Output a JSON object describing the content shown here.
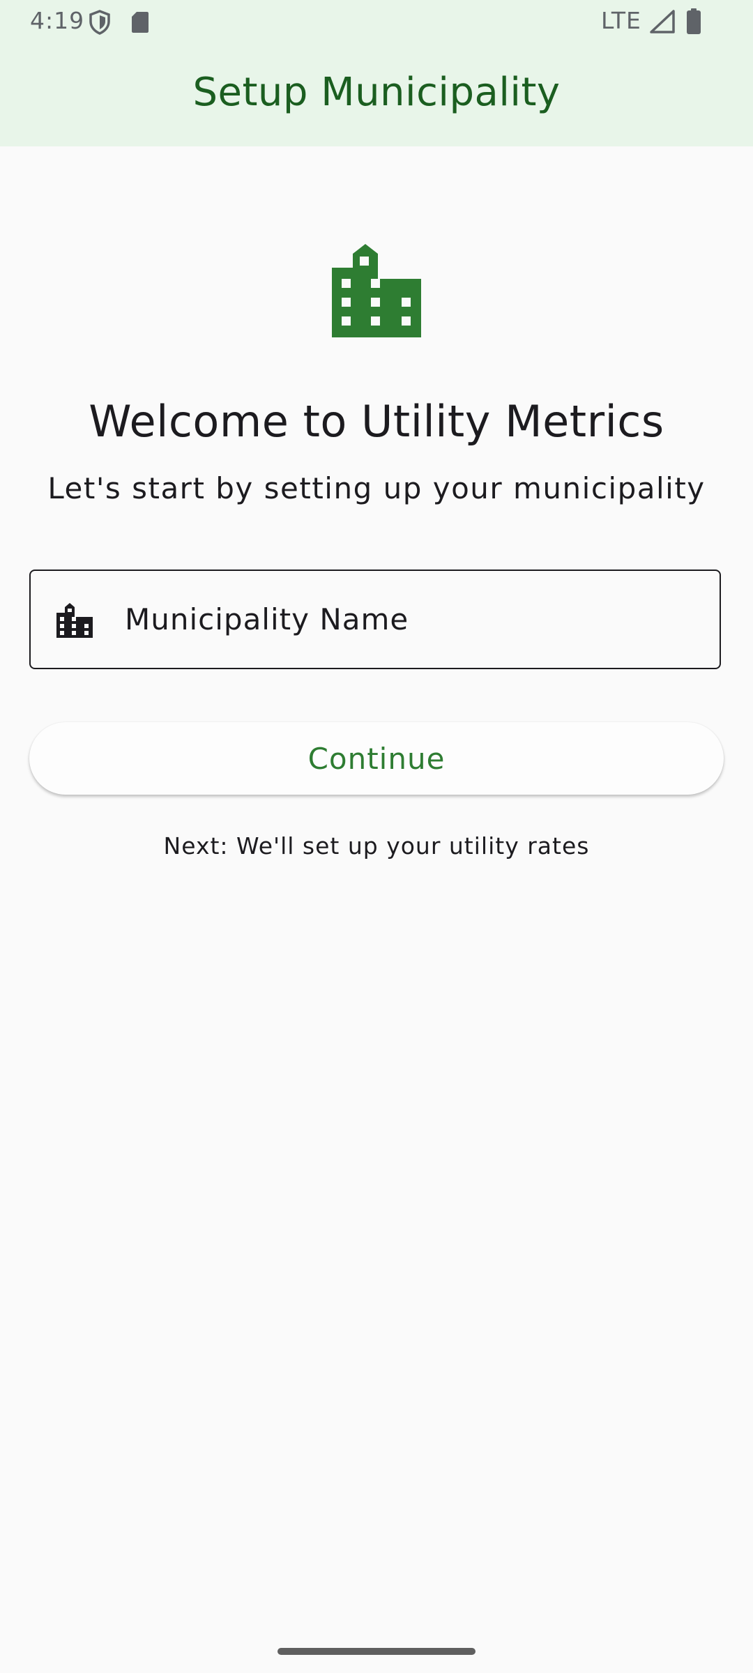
{
  "status_bar": {
    "time": "4:19",
    "network": "LTE",
    "icons": [
      "shield-icon",
      "sd-card-icon",
      "signal-icon",
      "battery-icon"
    ]
  },
  "app_bar": {
    "title": "Setup Municipality"
  },
  "main": {
    "hero_icon": "building-icon",
    "welcome_title": "Welcome to Utility Metrics",
    "welcome_subtitle": "Let's start by setting up your municipality",
    "municipality_field": {
      "label": "Municipality Name",
      "value": "",
      "icon": "building-icon"
    },
    "continue_label": "Continue",
    "next_note": "Next: We'll set up your utility rates"
  },
  "colors": {
    "app_bar_bg": "#e8f5e9",
    "primary_green": "#2e7d32",
    "title_green": "#1b5e20",
    "background": "#fafafa"
  }
}
